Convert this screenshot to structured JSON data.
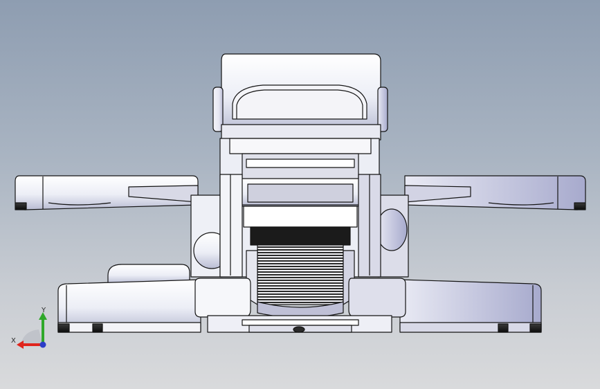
{
  "triad": {
    "x_label": "X",
    "y_label": "Y",
    "x_color": "#e0241c",
    "y_color": "#2fa82a",
    "z_color": "#2c3ec8"
  },
  "colors": {
    "bg_top": "#8e9db1",
    "bg_bottom": "#d9dadc",
    "part_fill": "#ffffff",
    "part_shade": "#c8c9dc",
    "edge": "#141414"
  }
}
